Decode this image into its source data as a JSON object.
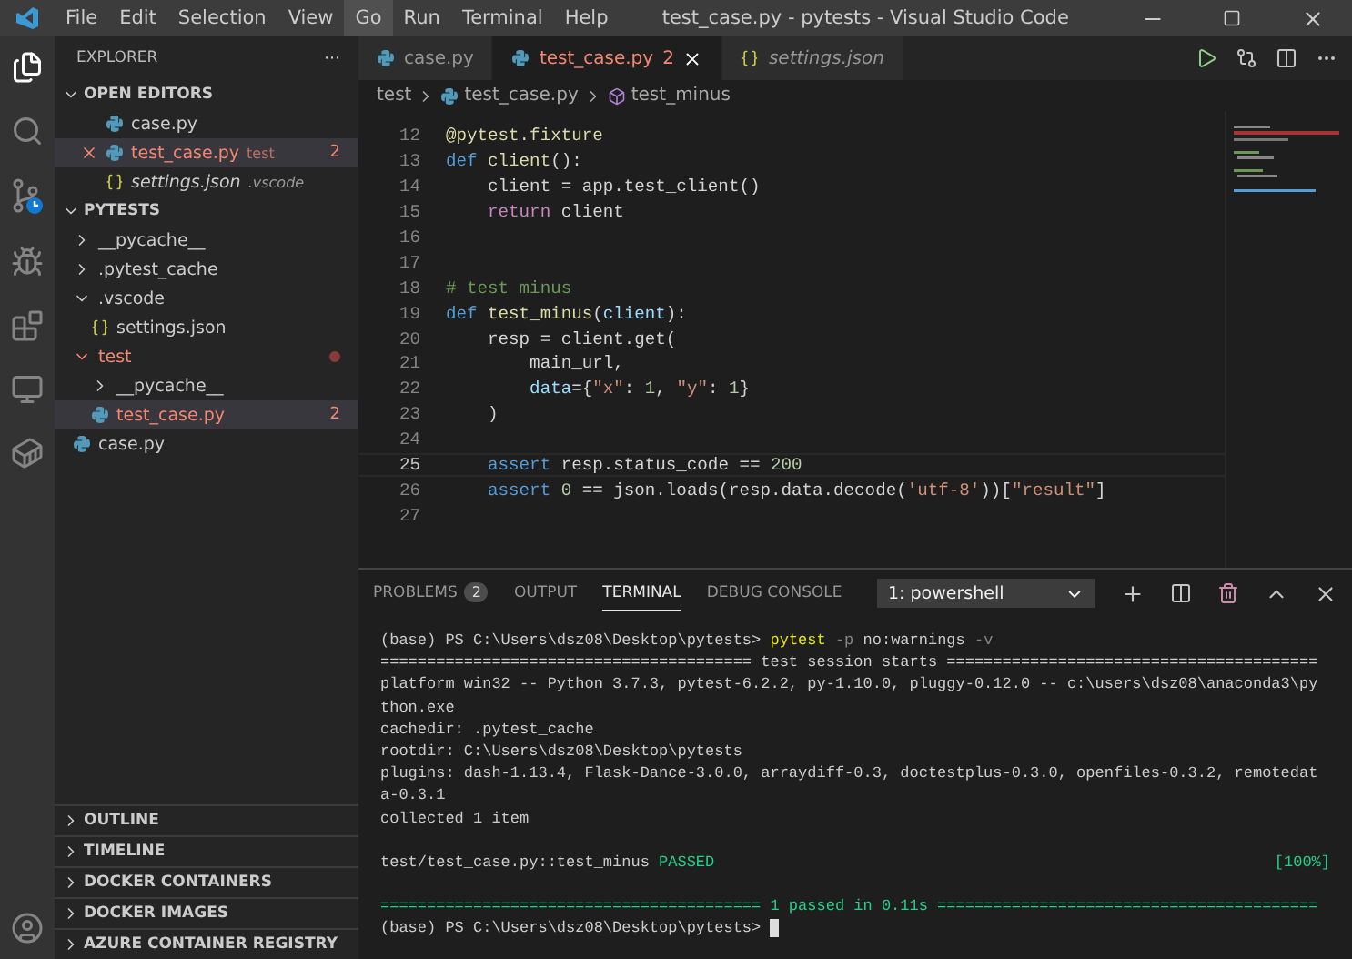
{
  "window": {
    "title": "test_case.py - pytests - Visual Studio Code"
  },
  "menu": [
    {
      "label": "File",
      "selected": false
    },
    {
      "label": "Edit",
      "selected": false
    },
    {
      "label": "Selection",
      "selected": false
    },
    {
      "label": "View",
      "selected": false
    },
    {
      "label": "Go",
      "selected": true
    },
    {
      "label": "Run",
      "selected": false
    },
    {
      "label": "Terminal",
      "selected": false
    },
    {
      "label": "Help",
      "selected": false
    }
  ],
  "sidebar": {
    "title": "EXPLORER",
    "more": "···",
    "open_editors": {
      "title": "OPEN EDITORS",
      "expanded": true,
      "items": [
        {
          "name": "case.py",
          "kind": "python",
          "selected": false,
          "error": false,
          "italic": false
        },
        {
          "name": "test_case.py",
          "kind": "python",
          "description": "test",
          "badge": "2",
          "selected": true,
          "error": true,
          "italic": false
        },
        {
          "name": "settings.json",
          "kind": "json",
          "description": ".vscode",
          "selected": false,
          "error": false,
          "italic": true
        }
      ]
    },
    "project": {
      "title": "PYTESTS",
      "expanded": true,
      "items": [
        {
          "name": "__pycache__",
          "kind": "folder",
          "expanded": false,
          "error": false,
          "selected": false
        },
        {
          "name": ".pytest_cache",
          "kind": "folder",
          "expanded": false,
          "error": false,
          "selected": false
        },
        {
          "name": ".vscode",
          "kind": "folder",
          "expanded": true,
          "error": false,
          "selected": false,
          "children": [
            {
              "name": "settings.json",
              "kind": "json",
              "error": false,
              "selected": false
            }
          ]
        },
        {
          "name": "test",
          "kind": "folder",
          "expanded": true,
          "error": true,
          "dot": true,
          "selected": false,
          "children": [
            {
              "name": "__pycache__",
              "kind": "folder",
              "expanded": false,
              "error": false,
              "selected": false
            },
            {
              "name": "test_case.py",
              "kind": "python",
              "error": true,
              "badge": "2",
              "selected": true
            }
          ]
        },
        {
          "name": "case.py",
          "kind": "python",
          "error": false,
          "selected": false
        }
      ]
    },
    "sections": [
      {
        "title": "OUTLINE",
        "expanded": false
      },
      {
        "title": "TIMELINE",
        "expanded": false
      },
      {
        "title": "DOCKER CONTAINERS",
        "expanded": false
      },
      {
        "title": "DOCKER IMAGES",
        "expanded": false
      },
      {
        "title": "AZURE CONTAINER REGISTRY",
        "expanded": false
      }
    ]
  },
  "tabs": [
    {
      "label": "case.py",
      "kind": "python",
      "selected": false,
      "error": false,
      "italic": false
    },
    {
      "label": "test_case.py",
      "kind": "python",
      "badge": "2",
      "selected": true,
      "error": true,
      "italic": false
    },
    {
      "label": "settings.json",
      "kind": "json",
      "selected": false,
      "error": false,
      "italic": true
    }
  ],
  "breadcrumb": [
    {
      "label": "test",
      "kind": "folder"
    },
    {
      "label": "test_case.py",
      "kind": "python"
    },
    {
      "label": "test_minus",
      "kind": "method"
    }
  ],
  "code": [
    {
      "number": "12",
      "current": false,
      "tokens": [
        {
          "kind": "dec",
          "text": "@pytest.fixture"
        }
      ]
    },
    {
      "number": "13",
      "current": false,
      "tokens": [
        {
          "kind": "kw",
          "text": "def "
        },
        {
          "kind": "fn",
          "text": "client"
        },
        {
          "kind": "plain",
          "text": "():"
        }
      ]
    },
    {
      "number": "14",
      "current": false,
      "tokens": [
        {
          "kind": "plain",
          "text": "    client = app.test_client()"
        }
      ]
    },
    {
      "number": "15",
      "current": false,
      "tokens": [
        {
          "kind": "ctrl",
          "text": "    return"
        },
        {
          "kind": "plain",
          "text": " client"
        }
      ]
    },
    {
      "number": "16",
      "current": false
    },
    {
      "number": "17",
      "current": false
    },
    {
      "number": "18",
      "current": false,
      "tokens": [
        {
          "kind": "comment",
          "text": "# test minus"
        }
      ]
    },
    {
      "number": "19",
      "current": false,
      "tokens": [
        {
          "kind": "kw",
          "text": "def "
        },
        {
          "kind": "fn",
          "text": "test_minus"
        },
        {
          "kind": "plain",
          "text": "("
        },
        {
          "kind": "var",
          "text": "client"
        },
        {
          "kind": "plain",
          "text": "):"
        }
      ]
    },
    {
      "number": "20",
      "current": false,
      "tokens": [
        {
          "kind": "plain",
          "text": "    resp = client.get("
        }
      ]
    },
    {
      "number": "21",
      "current": false,
      "tokens": [
        {
          "kind": "plain",
          "text": "        main_url,"
        }
      ]
    },
    {
      "number": "22",
      "current": false,
      "tokens": [
        {
          "kind": "var",
          "text": "        data"
        },
        {
          "kind": "plain",
          "text": "={"
        },
        {
          "kind": "str",
          "text": "\"x\""
        },
        {
          "kind": "plain",
          "text": ": "
        },
        {
          "kind": "num",
          "text": "1"
        },
        {
          "kind": "plain",
          "text": ", "
        },
        {
          "kind": "str",
          "text": "\"y\""
        },
        {
          "kind": "plain",
          "text": ": "
        },
        {
          "kind": "num",
          "text": "1"
        },
        {
          "kind": "plain",
          "text": "}"
        }
      ]
    },
    {
      "number": "23",
      "current": false,
      "tokens": [
        {
          "kind": "plain",
          "text": "    )"
        }
      ]
    },
    {
      "number": "24",
      "current": false
    },
    {
      "number": "25",
      "current": true,
      "tokens": [
        {
          "kind": "kw",
          "text": "    assert"
        },
        {
          "kind": "plain",
          "text": " resp.status_code == "
        },
        {
          "kind": "num",
          "text": "200"
        }
      ]
    },
    {
      "number": "26",
      "current": false,
      "tokens": [
        {
          "kind": "kw",
          "text": "    assert "
        },
        {
          "kind": "num",
          "text": "0"
        },
        {
          "kind": "plain",
          "text": " == json.loads(resp.data.decode("
        },
        {
          "kind": "str",
          "text": "'utf-8'"
        },
        {
          "kind": "plain",
          "text": "))["
        },
        {
          "kind": "str",
          "text": "\"result\""
        },
        {
          "kind": "plain",
          "text": "]"
        }
      ]
    },
    {
      "number": "27",
      "current": false
    }
  ],
  "panel": {
    "tabs": [
      {
        "label": "PROBLEMS",
        "badge": "2",
        "selected": false
      },
      {
        "label": "OUTPUT",
        "selected": false
      },
      {
        "label": "TERMINAL",
        "selected": true
      },
      {
        "label": "DEBUG CONSOLE",
        "selected": false
      }
    ],
    "terminal_select": "1: powershell",
    "terminal": [
      {
        "segments": [
          {
            "kind": "plain",
            "text": "(base) PS C:\\Users\\dsz08\\Desktop\\pytests> "
          },
          {
            "kind": "cmd",
            "text": "pytest"
          },
          {
            "kind": "flag",
            "text": " -p"
          },
          {
            "kind": "plain",
            "text": " no:warnings"
          },
          {
            "kind": "flag",
            "text": " -v"
          }
        ]
      },
      {
        "segments": [
          {
            "kind": "plain",
            "text": "======================================== test session starts ========================================"
          }
        ]
      },
      {
        "segments": [
          {
            "kind": "plain",
            "text": "platform win32 -- Python 3.7.3, pytest-6.2.2, py-1.10.0, pluggy-0.12.0 -- c:\\users\\dsz08\\anaconda3\\py"
          }
        ]
      },
      {
        "segments": [
          {
            "kind": "plain",
            "text": "thon.exe"
          }
        ]
      },
      {
        "segments": [
          {
            "kind": "plain",
            "text": "cachedir: .pytest_cache"
          }
        ]
      },
      {
        "segments": [
          {
            "kind": "plain",
            "text": "rootdir: C:\\Users\\dsz08\\Desktop\\pytests"
          }
        ]
      },
      {
        "segments": [
          {
            "kind": "plain",
            "text": "plugins: dash-1.13.4, Flask-Dance-3.0.0, arraydiff-0.3, doctestplus-0.3.0, openfiles-0.3.2, remotedat"
          }
        ]
      },
      {
        "segments": [
          {
            "kind": "plain",
            "text": "a-0.3.1"
          }
        ]
      },
      {
        "segments": [
          {
            "kind": "plain",
            "text": "collected 1 item"
          }
        ]
      },
      {
        "gap_above": true,
        "segments": [
          {
            "kind": "plain",
            "text": "test/test_case.py::test_minus "
          },
          {
            "kind": "pass",
            "text": "PASSED"
          }
        ],
        "right": "[100%]"
      },
      {
        "gap_above": true,
        "segments": [
          {
            "kind": "pass",
            "text": "========================================= 1 passed in 0.11s ========================================="
          }
        ]
      },
      {
        "segments": [
          {
            "kind": "plain",
            "text": "(base) PS C:\\Users\\dsz08\\Desktop\\pytests> "
          }
        ],
        "cursor": true
      }
    ]
  }
}
